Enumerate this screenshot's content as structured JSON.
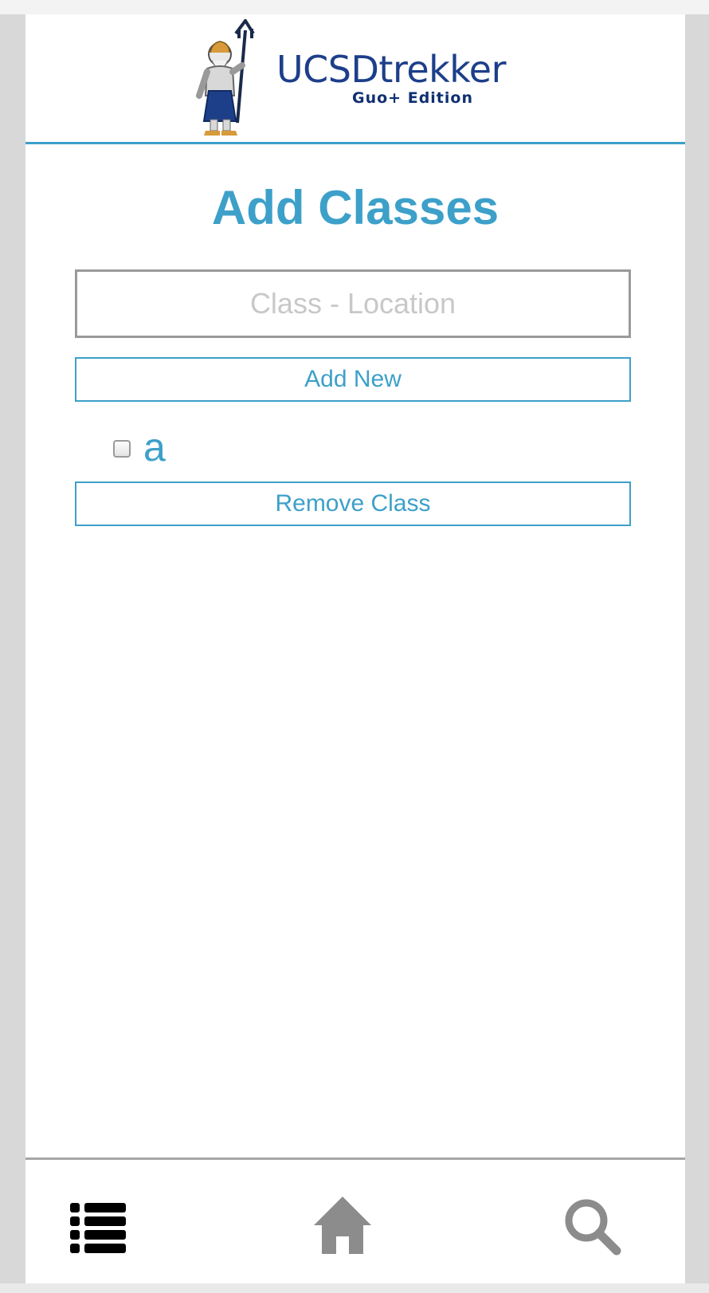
{
  "header": {
    "logo_title": "UCSDtrekker",
    "logo_subtitle": "Guo+ Edition",
    "logo_icon": "trident-mascot-icon"
  },
  "page": {
    "title": "Add Classes"
  },
  "form": {
    "input_value": "",
    "input_placeholder": "Class - Location",
    "add_button_label": "Add New"
  },
  "classes": [
    {
      "name": "a",
      "checked": false
    }
  ],
  "actions": {
    "remove_button_label": "Remove Class"
  },
  "footer_nav": {
    "items": [
      {
        "icon": "list-icon",
        "color": "#000000"
      },
      {
        "icon": "home-icon",
        "color": "#8c8c8c"
      },
      {
        "icon": "search-icon",
        "color": "#8c8c8c"
      }
    ]
  },
  "colors": {
    "accent": "#3da0c9",
    "logo_text": "#1d3f8a"
  }
}
